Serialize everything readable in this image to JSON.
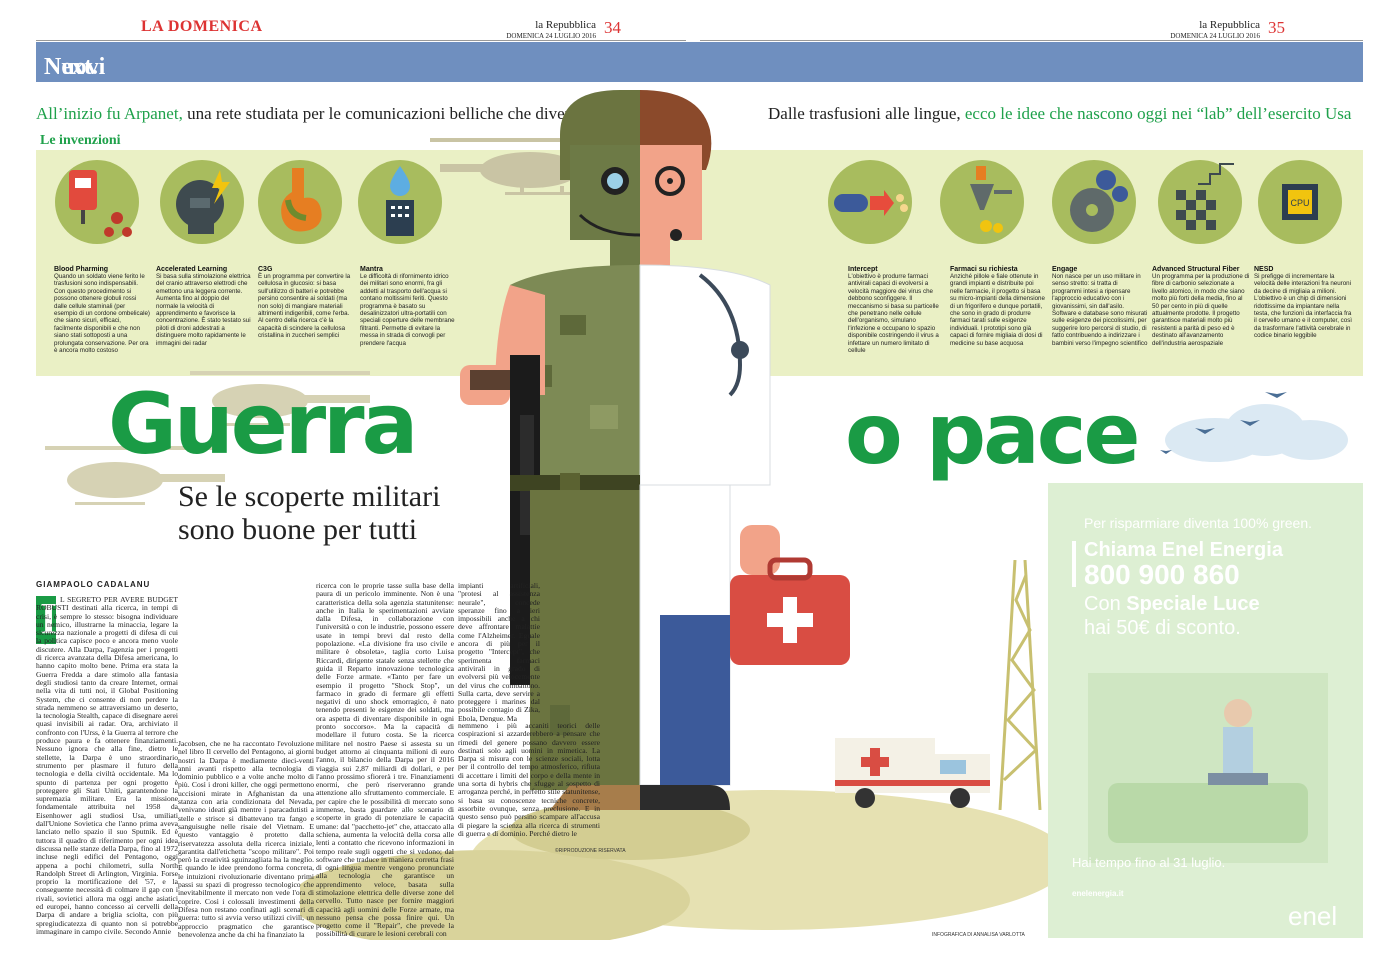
{
  "header": {
    "left_masthead": "LA DOMENICA",
    "left_paper": "la Repubblica",
    "left_date": "DOMENICA 24 LUGLIO 2016",
    "left_page": "34",
    "right_paper": "la Repubblica",
    "right_date": "DOMENICA 24 LUGLIO 2016",
    "right_page": "35"
  },
  "section": {
    "a": "Next.",
    "b": "Nuovi fronti"
  },
  "kicker_left": {
    "a": "All’inizio fu Arpanet,",
    "b": " una rete studiata per le comunicazioni belliche che diventerà Internet"
  },
  "kicker_right": {
    "a": "Dalle trasfusioni alle lingue,",
    "b": " ecco le idee che nascono oggi nei “lab” dell’esercito Usa"
  },
  "inventions_title": "Le invenzioni",
  "inventions": [
    {
      "title": "Blood Pharming",
      "text": "Quando un soldato viene ferito le trasfusioni sono indispensabili. Con questo procedimento si possono ottenere globuli rossi dalle cellule staminali (per esempio di un cordone ombelicale) che siano sicuri, efficaci, facilmente disponibili e che non siano stati sottoposti a una prolungata conservazione. Per ora è ancora molto costoso"
    },
    {
      "title": "Accelerated Learning",
      "text": "Si basa sulla stimolazione elettrica del cranio attraverso elettrodi che emettono una leggera corrente. Aumenta fino al doppio del normale la velocità di apprendimento e favorisce la concentrazione. È stato testato sui piloti di droni addestrati a distinguere molto rapidamente le immagini dei radar"
    },
    {
      "title": "C3G",
      "text": "È un programma per convertire la cellulosa in glucosio: si basa sull'utilizzo di batteri e potrebbe persino consentire ai soldati (ma non solo) di mangiare materiali altrimenti indigeribili, come l'erba. Al centro della ricerca c'è la capacità di scindere la cellulosa cristallina in zuccheri semplici"
    },
    {
      "title": "Mantra",
      "text": "Le difficoltà di rifornimento idrico dei militari sono enormi, fra gli addetti al trasporto dell'acqua si contano moltissimi feriti. Questo programma è basato su desalinizzatori ultra-portatili con speciali coperture delle membrane filtranti. Permette di evitare la messa in strada di convogli per prendere l'acqua"
    },
    {
      "title": "Intercept",
      "text": "L'obiettivo è produrre farmaci antivirali capaci di evolversi a velocità maggiore dei virus che debbono sconfiggere. Il meccanismo si basa su particelle che penetrano nelle cellule dell'organismo, simulano l'infezione e occupano lo spazio disponibile costringendo il virus a infettare un numero limitato di cellule"
    },
    {
      "title": "Farmaci su richiesta",
      "text": "Anziché pillole e fiale ottenute in grandi impianti e distribuite poi nelle farmacie, il progetto si basa su micro-impianti della dimensione di un frigorifero e dunque portatili, che sono in grado di produrre farmaci tarati sulle esigenze individuali. I prototipi sono già capaci di fornire migliaia di dosi di medicine su base acquosa"
    },
    {
      "title": "Engage",
      "text": "Non nasce per un uso militare in senso stretto: si tratta di programmi intesi a ripensare l'approccio educativo con i giovanissimi, sin dall'asilo. Software e database sono misurati sulle esigenze dei piccolissimi, per suggerire loro percorsi di studio, di fatto contribuendo a indirizzare i bambini verso l'impegno scientifico"
    },
    {
      "title": "Advanced Structural Fiber",
      "text": "Un programma per la produzione di fibre di carbonio selezionate a livello atomico, in modo che siano molto più forti della media, fino al 50 per cento in più di quelle attualmente prodotte. Il progetto garantisce materiali molto più resistenti a parità di peso ed è destinato all'avanzamento dell'industria aerospaziale"
    },
    {
      "title": "NESD",
      "text": "Si prefigge di incrementare la velocità delle interazioni fra neuroni da decine di migliaia a milioni. L'obiettivo è un chip di dimensioni ridottissime da impiantare nella testa, che funzioni da interfaccia fra il cervello umano e il computer, così da trasformare l'attività cerebrale in codice binario leggibile"
    }
  ],
  "headline_left": "Guerra",
  "headline_right": "o pace",
  "subhead_1": "Se le scoperte militari",
  "subhead_2": "sono buone per tutti",
  "byline": "GIAMPAOLO CADALANU",
  "dropcap": "I",
  "article": [
    "L SEGRETO PER AVERE BUDGET ROBUSTI destinati alla ricerca, in tempi di crisi, è sempre lo stesso: bisogna individuare un nemico, illustrarne la minaccia, legare la sicurezza nazionale a progetti di difesa di cui la politica capisce poco e ancora meno vuole discutere. Alla Darpa, l'agenzia per i progetti di ricerca avanzata della Difesa americana, lo hanno capito molto bene. Prima era stata la Guerra Fredda a dare stimolo alla fantasia degli studiosi tanto da creare Internet, ormai nella vita di tutti noi, il Global Positioning System, che ci consente di non perdere la strada nemmeno se attraversiamo un deserto, la tecnologia Stealth, capace di disegnare aerei quasi invisibili ai radar. Ora, archiviato il confronto con l'Urss, è la Guerra al terrore che produce paura e fa ottenere finanziamenti. Nessuno ignora che alla fine, dietro le stellette, la Darpa è uno straordinario strumento per plasmare il futuro della tecnologia e della civiltà occidentale. Ma lo spunto di partenza per ogni progetto è proteggere gli Stati Uniti, garantendone la supremazia militare. Era la missione fondamentale attribuita nel 1958 da Eisenhower agli studiosi Usa, umiliati dall'Unione Sovietica che l'anno prima aveva lanciato nello spazio il suo Sputnik. Ed è tuttora il quadro di riferimento per ogni idea discussa nelle stanze della Darpa, fino al 1972 incluse negli edifici del Pentagono, oggi appena a pochi chilometri, sulla North Randolph Street di Arlington, Virginia. Forse proprio la mortificazione del '57, e la conseguente necessità di colmare il gap con i rivali, sovietici allora ma oggi anche asiatici ed europei, hanno concesso ai cervelli della Darpa di andare a briglia sciolta, con più spregiudicatezza di quanto non si potrebbe immaginare in campo civile. Secondo Annie Jacobsen, che ne ha raccontato l'evoluzione nel libro Il cervello del Pentagono, ai giorni nostri la Darpa è mediamente dieci-venti anni avanti rispetto alla tecnologia di dominio pubblico e a volte anche molto di più. Così i droni killer, che oggi permettono uccisioni mirate in Afghanistan da una stanza con aria condizionata del Nevada, venivano ideati già mentre i paracadutisti a stelle e strisce si dibattevano tra fango e sanguisughe nelle risaie del Vietnam. E questo vantaggio è protetto dalla riservatezza assoluta della ricerca iniziale, garantita dall'etichetta \"scopo militare\". Poi però la creatività sguinzagliata ha la meglio. E quando le idee prendono forma concreta, le intuizioni rivoluzionarie diventano primi passi su spazi di progresso tecnologico che inevitabilmente il mercato non vede l'ora di coprire. Così i colossali investimenti della Difesa non restano confinati agli scenari di guerra: tutto si avvia verso utilizzi civili, un approccio pragmatico che garantisce benevolenza anche da chi ha finanziato la ricerca con le proprie tasse sulla base della paura di un pericolo imminente. Non è una caratteristica della sola agenzia statunitense: anche in Italia le sperimentazioni avviate dalla Difesa, in collaborazione con l'università o con le industrie, possono essere usate in tempi brevi dal resto della popolazione. «La divisione fra uso civile e militare è obsoleta», taglia corto Luisa Riccardi, dirigente statale senza stellette che guida il Reparto innovazione tecnologica delle Forze armate. «Tanto per fare un esempio il progetto \"Shock Stop\", un farmaco in grado di fermare gli effetti negativi di uno shock emorragico, è nato tenendo presenti le esigenze dei soldati, ma ora aspetta di diventare disponibile in ogni pronto soccorso». Ma la capacità di modellare il futuro costa. Se la ricerca militare nel nostro Paese si assesta su un budget attorno ai cinquanta milioni di euro l'anno, il bilancio della Darpa per il 2016 viaggia sui 2,87 miliardi di dollari, e per l'anno prossimo sfiorerà i tre. Finanziamenti enormi, che però riserveranno grande attenzione allo sfruttamento commerciale. E per capire che le possibilità di mercato sono immense, basta guardare allo scenario di scoperte in grado di potenziare le capacità umane: dal \"pacchetto-jet\" che, attaccato alla schiena, aumenta la velocità della corsa alle lenti a contatto che ricevono informazioni in tempo reale sugli oggetti che si vedono; dal software che traduce in maniera corretta frasi di ogni lingua mentre vengono pronunciate alla tecnologia che garantisce un apprendimento veloce, basata sulla stimolazione elettrica delle diverse zone del cervello. Tutto nasce per fornire maggiori capacità agli uomini delle Forze armate, ma nessuno pensa che possa finire qui. Un progetto come il \"Repair\", che prevede la possibilità di curare le lesioni cerebrali con impianti artificiali, \"protesi al assistenza neurale\", concede speranze fino a ieri impossibili anche a chi deve affrontare malattie come l'Alzheimer. Eguale ancora di più per il progetto \"Intercept\", che sperimenta farmaci antivirali in grado di evolversi più velocemente del virus che combattono. Sulla carta, deve servire a proteggere i marines dal possibile contagio di Zika, Ebola, Dengue. Ma nemmeno i più accaniti teorici delle cospirazioni si azzarderebbero a pensare che rimedi del genere possano davvero essere destinati solo agli uomini in mimetica. La Darpa si misura con le scienze sociali, lotta per il controllo del tempo atmosferico, rifiuta di accettare i limiti del corpo e della mente in una sorta di hybris che sfugge al sospetto di arroganza perché, in perfetto stile statunitense, si basa su conoscenze tecniche concrete, assorbite ovunque, senza preclusione. E in questo senso può persino scampare all'accusa di piegare la scienza alla ricerca di strumenti di guerra e di dominio. Perché dietro le scoperte, a decidere come usare gli strumenti, a scegliere se distribuire morte o guarigione, e dunque a prenderne la responsabilità, oggi come sempre, sono gli uomini."
  ],
  "credits": {
    "repro": "©RIPRODUZIONE RISERVATA",
    "infographic": "INFOGRAFICA DI ANNALISA VARLOTTA"
  },
  "ad": {
    "line1": "Per risparmiare diventa 100% green.",
    "line2": "Chiama Enel Energia",
    "phone": "800 900 860",
    "line3a": "Con ",
    "line3b": "Speciale Luce",
    "line4": "hai 50€ di sconto.",
    "deadline": "Hai tempo fino al 31 luglio.",
    "url": "enelenergia.it",
    "logo": "enel"
  },
  "colors": {
    "green": "#1a9b45",
    "band_blue": "#6f8fbf",
    "inv_band": "#eaf0c5",
    "red_case": "#d94d43",
    "olive": "#a8bc5e"
  },
  "icons": [
    "blood-bag-icon",
    "brain-lightning-icon",
    "stomach-icon",
    "water-drop-filter-icon",
    "capsule-icon",
    "factory-pill-icon",
    "gears-disc-icon",
    "checker-fiber-icon",
    "cpu-chip-icon"
  ]
}
